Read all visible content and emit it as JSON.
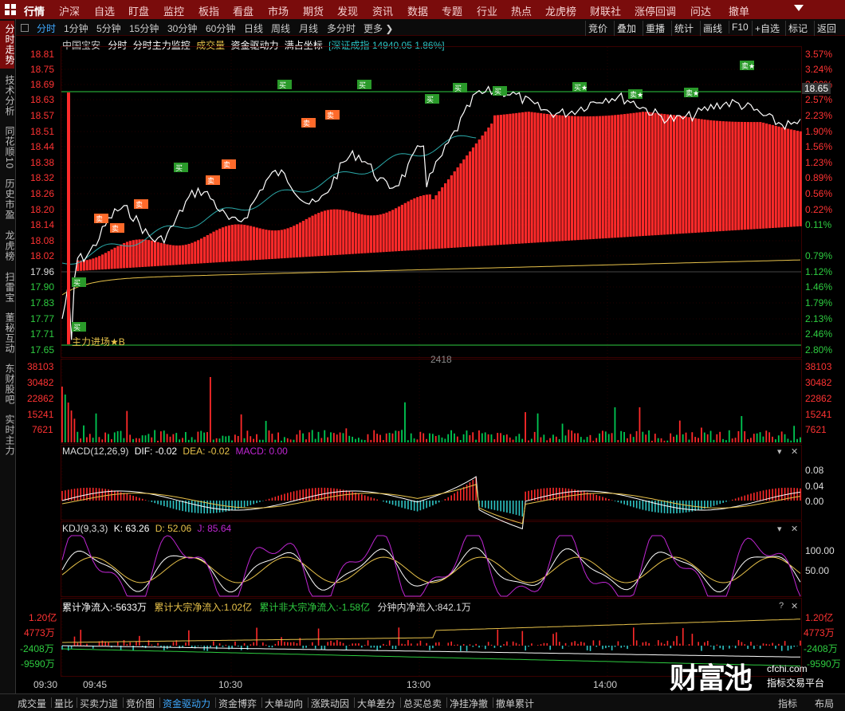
{
  "top_menu": {
    "items": [
      "行情",
      "沪深",
      "自选",
      "盯盘",
      "监控",
      "板指",
      "看盘",
      "市场",
      "期货",
      "发现",
      "资讯",
      "数据",
      "专题",
      "行业",
      "热点",
      "龙虎榜",
      "财联社",
      "涨停回调",
      "问达",
      "撤单"
    ],
    "active": 0
  },
  "left_tabs": [
    "分时走势",
    "技术分析",
    "同花顺10",
    "历史市盈",
    "龙虎榜",
    "扫雷宝",
    "董秘互动",
    "东财股吧",
    "实时主力"
  ],
  "period_tabs": {
    "items": [
      "分时",
      "1分钟",
      "5分钟",
      "15分钟",
      "30分钟",
      "60分钟",
      "日线",
      "周线",
      "月线",
      "多分时",
      "更多 ❯"
    ],
    "active": 0
  },
  "toolbar": {
    "items": [
      "竞价",
      "叠加",
      "重播",
      "统计",
      "画线",
      "F10",
      "+自选",
      "标记",
      "返回"
    ]
  },
  "info_bar": {
    "stock_name": "中国宝安",
    "items": [
      "分时",
      "分时主力监控"
    ],
    "volume_label": "成交量",
    "fund_label": "资金驱动力",
    "coord_label": "满占坐标",
    "index_text": "[深证成指 14940.05 1.86%]"
  },
  "price_axis": [
    "18.81",
    "18.75",
    "18.69",
    "18.63",
    "18.57",
    "18.51",
    "18.44",
    "18.38",
    "18.32",
    "18.26",
    "18.20",
    "18.14",
    "18.08",
    "18.02",
    "17.96",
    "17.90",
    "17.83",
    "17.77",
    "17.71",
    "17.65"
  ],
  "pct_axis": [
    "3.57%",
    "3.24%",
    "2.90%",
    "2.57%",
    "2.23%",
    "1.90%",
    "1.56%",
    "1.23%",
    "0.89%",
    "0.56%",
    "0.22%",
    "0.11%",
    "0.79%",
    "1.12%",
    "1.46%",
    "1.79%",
    "2.13%",
    "2.46%",
    "2.80%"
  ],
  "current_price": "18.65",
  "main_entry_label": "主力进场★B",
  "center_value": "2418",
  "signals": [
    {
      "text": "买",
      "kind": "buy"
    },
    {
      "text": "卖",
      "kind": "sell"
    },
    {
      "text": "买★",
      "kind": "buy"
    },
    {
      "text": "卖★",
      "kind": "star"
    }
  ],
  "volume_axis": [
    "38103",
    "30482",
    "22862",
    "15241",
    "7621"
  ],
  "macd": {
    "title": "MACD(12,26,9)",
    "dif": "DIF: -0.02",
    "dea": "DEA: -0.02",
    "macd": "MACD: 0.00",
    "axis": [
      "0.08",
      "0.04",
      "0.00"
    ]
  },
  "kdj": {
    "title": "KDJ(9,3,3)",
    "k": "K: 63.26",
    "d": "D: 52.06",
    "j": "J: 85.64",
    "axis": [
      "100.00",
      "50.00"
    ]
  },
  "flow": {
    "net": "累计净流入:-5633万",
    "big": "累计大宗净流入:1.02亿",
    "nonbig": "累计非大宗净流入:-1.58亿",
    "minute": "分钟内净流入:842.1万",
    "axis_left": [
      "1.20亿",
      "4773万",
      "-2408万",
      "-9590万"
    ],
    "axis_right": [
      "1.20亿",
      "4773万",
      "-2408万",
      "-9590万"
    ]
  },
  "time_axis": [
    "09:30",
    "09:45",
    "10:30",
    "13:00",
    "14:00"
  ],
  "bottom_tabs": {
    "items": [
      "成交量",
      "量比",
      "买卖力道",
      "竞价图",
      "资金驱动力",
      "资金博弈",
      "大单动向",
      "涨跌动因",
      "大单差分",
      "总买总卖",
      "净挂净撤",
      "撤单累计"
    ],
    "active": 4
  },
  "bottom_right": [
    "指标",
    "布局"
  ],
  "watermark": {
    "brand": "财富池",
    "site": "cfchi.com",
    "tagline": "指标交易平台"
  },
  "colors": {
    "up": "#ff2a2a",
    "down": "#00c853",
    "price_line": "#ffffff",
    "avg_line": "#e8c24a",
    "index_line": "#2aa8a8",
    "menu_bg": "#7a0c0c"
  }
}
